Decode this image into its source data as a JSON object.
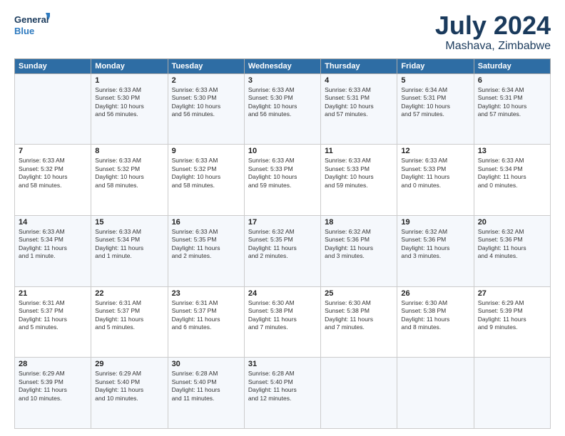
{
  "logo": {
    "line1": "General",
    "line2": "Blue"
  },
  "title": {
    "month": "July 2024",
    "location": "Mashava, Zimbabwe"
  },
  "columns": [
    "Sunday",
    "Monday",
    "Tuesday",
    "Wednesday",
    "Thursday",
    "Friday",
    "Saturday"
  ],
  "weeks": [
    [
      {
        "day": "",
        "content": ""
      },
      {
        "day": "1",
        "content": "Sunrise: 6:33 AM\nSunset: 5:30 PM\nDaylight: 10 hours\nand 56 minutes."
      },
      {
        "day": "2",
        "content": "Sunrise: 6:33 AM\nSunset: 5:30 PM\nDaylight: 10 hours\nand 56 minutes."
      },
      {
        "day": "3",
        "content": "Sunrise: 6:33 AM\nSunset: 5:30 PM\nDaylight: 10 hours\nand 56 minutes."
      },
      {
        "day": "4",
        "content": "Sunrise: 6:33 AM\nSunset: 5:31 PM\nDaylight: 10 hours\nand 57 minutes."
      },
      {
        "day": "5",
        "content": "Sunrise: 6:34 AM\nSunset: 5:31 PM\nDaylight: 10 hours\nand 57 minutes."
      },
      {
        "day": "6",
        "content": "Sunrise: 6:34 AM\nSunset: 5:31 PM\nDaylight: 10 hours\nand 57 minutes."
      }
    ],
    [
      {
        "day": "7",
        "content": "Sunrise: 6:33 AM\nSunset: 5:32 PM\nDaylight: 10 hours\nand 58 minutes."
      },
      {
        "day": "8",
        "content": "Sunrise: 6:33 AM\nSunset: 5:32 PM\nDaylight: 10 hours\nand 58 minutes."
      },
      {
        "day": "9",
        "content": "Sunrise: 6:33 AM\nSunset: 5:32 PM\nDaylight: 10 hours\nand 58 minutes."
      },
      {
        "day": "10",
        "content": "Sunrise: 6:33 AM\nSunset: 5:33 PM\nDaylight: 10 hours\nand 59 minutes."
      },
      {
        "day": "11",
        "content": "Sunrise: 6:33 AM\nSunset: 5:33 PM\nDaylight: 10 hours\nand 59 minutes."
      },
      {
        "day": "12",
        "content": "Sunrise: 6:33 AM\nSunset: 5:33 PM\nDaylight: 11 hours\nand 0 minutes."
      },
      {
        "day": "13",
        "content": "Sunrise: 6:33 AM\nSunset: 5:34 PM\nDaylight: 11 hours\nand 0 minutes."
      }
    ],
    [
      {
        "day": "14",
        "content": "Sunrise: 6:33 AM\nSunset: 5:34 PM\nDaylight: 11 hours\nand 1 minute."
      },
      {
        "day": "15",
        "content": "Sunrise: 6:33 AM\nSunset: 5:34 PM\nDaylight: 11 hours\nand 1 minute."
      },
      {
        "day": "16",
        "content": "Sunrise: 6:33 AM\nSunset: 5:35 PM\nDaylight: 11 hours\nand 2 minutes."
      },
      {
        "day": "17",
        "content": "Sunrise: 6:32 AM\nSunset: 5:35 PM\nDaylight: 11 hours\nand 2 minutes."
      },
      {
        "day": "18",
        "content": "Sunrise: 6:32 AM\nSunset: 5:36 PM\nDaylight: 11 hours\nand 3 minutes."
      },
      {
        "day": "19",
        "content": "Sunrise: 6:32 AM\nSunset: 5:36 PM\nDaylight: 11 hours\nand 3 minutes."
      },
      {
        "day": "20",
        "content": "Sunrise: 6:32 AM\nSunset: 5:36 PM\nDaylight: 11 hours\nand 4 minutes."
      }
    ],
    [
      {
        "day": "21",
        "content": "Sunrise: 6:31 AM\nSunset: 5:37 PM\nDaylight: 11 hours\nand 5 minutes."
      },
      {
        "day": "22",
        "content": "Sunrise: 6:31 AM\nSunset: 5:37 PM\nDaylight: 11 hours\nand 5 minutes."
      },
      {
        "day": "23",
        "content": "Sunrise: 6:31 AM\nSunset: 5:37 PM\nDaylight: 11 hours\nand 6 minutes."
      },
      {
        "day": "24",
        "content": "Sunrise: 6:30 AM\nSunset: 5:38 PM\nDaylight: 11 hours\nand 7 minutes."
      },
      {
        "day": "25",
        "content": "Sunrise: 6:30 AM\nSunset: 5:38 PM\nDaylight: 11 hours\nand 7 minutes."
      },
      {
        "day": "26",
        "content": "Sunrise: 6:30 AM\nSunset: 5:38 PM\nDaylight: 11 hours\nand 8 minutes."
      },
      {
        "day": "27",
        "content": "Sunrise: 6:29 AM\nSunset: 5:39 PM\nDaylight: 11 hours\nand 9 minutes."
      }
    ],
    [
      {
        "day": "28",
        "content": "Sunrise: 6:29 AM\nSunset: 5:39 PM\nDaylight: 11 hours\nand 10 minutes."
      },
      {
        "day": "29",
        "content": "Sunrise: 6:29 AM\nSunset: 5:40 PM\nDaylight: 11 hours\nand 10 minutes."
      },
      {
        "day": "30",
        "content": "Sunrise: 6:28 AM\nSunset: 5:40 PM\nDaylight: 11 hours\nand 11 minutes."
      },
      {
        "day": "31",
        "content": "Sunrise: 6:28 AM\nSunset: 5:40 PM\nDaylight: 11 hours\nand 12 minutes."
      },
      {
        "day": "",
        "content": ""
      },
      {
        "day": "",
        "content": ""
      },
      {
        "day": "",
        "content": ""
      }
    ]
  ]
}
